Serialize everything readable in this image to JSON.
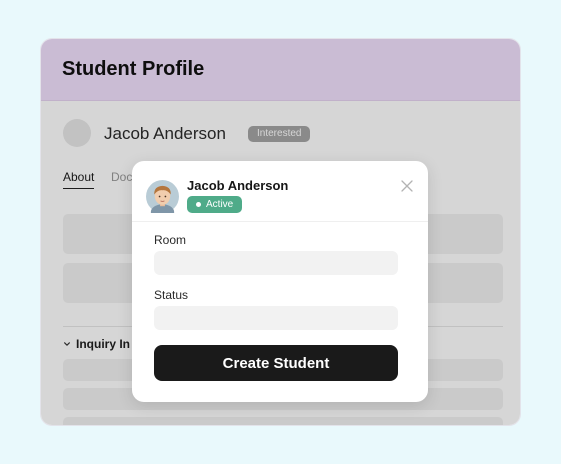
{
  "page": {
    "title": "Student Profile"
  },
  "profile": {
    "name": "Jacob Anderson",
    "badge": "Interested",
    "tabs": [
      "About",
      "Doc"
    ],
    "section_label": "Inquiry In"
  },
  "modal": {
    "name": "Jacob Anderson",
    "status": "Active",
    "room_label": "Room",
    "room_value": "",
    "status_label": "Status",
    "status_value": "",
    "submit_label": "Create Student",
    "close_icon": "close-icon"
  },
  "colors": {
    "background": "#e9f9fc",
    "header": "#f1e0fd",
    "active_badge": "#4fab89",
    "interested_badge": "#a5a5a5",
    "primary_button": "#1a1a1a"
  }
}
